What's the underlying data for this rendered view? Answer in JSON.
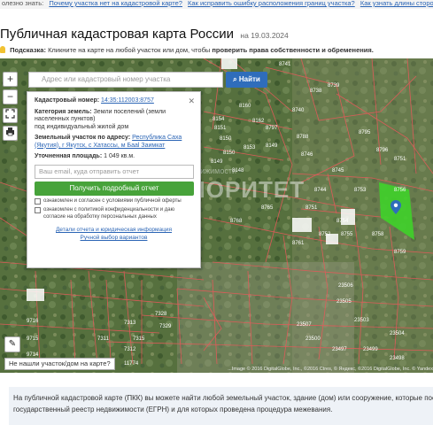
{
  "topbar": {
    "prefix": "олезно знать:",
    "links": [
      "Почему участка нет на кадастровой карте?",
      "Как исправить ошибку расположения границ участка?",
      "Как узнать длины сторон участка?"
    ]
  },
  "header": {
    "title": "Публичная кадастровая карта России",
    "date": "на 19.03.2024"
  },
  "hint": {
    "label": "Подсказка:",
    "text": "Кликните на карте на любой участок или дом, чтобы",
    "bold": "проверить права собственности и обременения."
  },
  "map": {
    "search_placeholder": "Адрес или кадастровый номер участка",
    "search_button": "Найти",
    "zoom_in": "+",
    "zoom_out": "−",
    "not_found": "Не нашли участок/дом на карте?",
    "attribution": "...Image © 2016 DigitalGlobe, Inc., ©2016 Ctres, © Яндекс, ©2016 DigitalGlobe, Inc. © Yandex"
  },
  "popup": {
    "cad_label": "Кадастровый номер:",
    "cad_value": "14:35:112003:8757",
    "cat_label": "Категория земель:",
    "cat_value": "Земли поселений (земли населенных пунктов)",
    "use_value": "под индивидуальный жилой дом",
    "addr_label": "Земельный участок по адресу:",
    "addr_value": "Республика Саха (Якутия), г Якутск, с Хатассы, м Бааl Заимкат",
    "area_label": "Уточненная площадь:",
    "area_value": "1 049 кв.м.",
    "email_placeholder": "Ваш email, куда отправить отчет",
    "get_button": "Получить подробный отчет",
    "consent1": "ознакомлен и согласен с условиями публичной оферты",
    "consent2": "ознакомлен с политикой конфиденциальности и даю согласие на обработку персональных данных",
    "link_details": "Детали отчета и юридическая информация",
    "link_manual": "Ручной выбор вариантов"
  },
  "watermark": {
    "top": "Центр недвижимости",
    "main": "ПРИОРИТЕТ"
  },
  "plot_numbers": [
    "8739",
    "8738",
    "8741",
    "8740",
    "8797",
    "8788",
    "8795",
    "8796",
    "8751",
    "8753",
    "8756",
    "8755",
    "8758",
    "8759",
    "8160",
    "8162",
    "8154",
    "8151",
    "8150",
    "8150",
    "8149",
    "8148",
    "8153",
    "8149",
    "8746",
    "8745",
    "8744",
    "8751",
    "8754",
    "8752",
    "8761",
    "8765",
    "8768",
    "9716",
    "9715",
    "9714",
    "23506",
    "23505",
    "23507",
    "23503",
    "23504",
    "23500",
    "23497",
    "23499",
    "23498",
    "7313",
    "7311",
    "7315",
    "7312",
    "11774",
    "7328",
    "7329"
  ],
  "footer": {
    "line1": "На публичной кадастровой карте (ПКК) вы можете найти любой земельный участок, здание (дом) или сооружение, которые пос",
    "line2": "государственный реестр недвижимости (ЕГРН) и для которых проведена процедура межевания."
  }
}
